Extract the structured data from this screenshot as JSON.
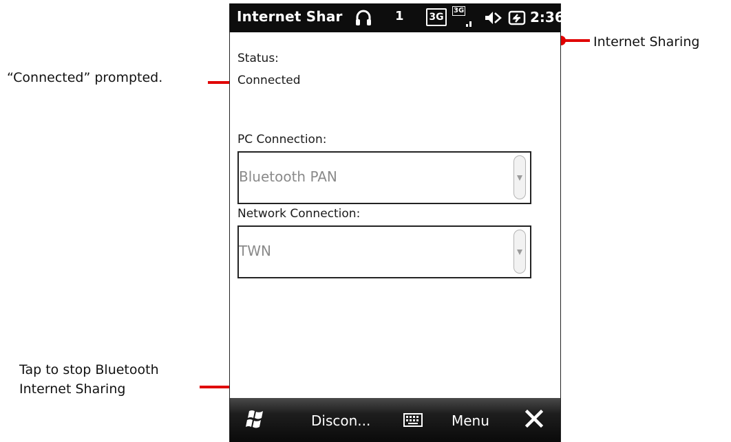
{
  "status_bar": {
    "title": "Internet Shar",
    "headset_icon": "headset-icon",
    "line_indicator": "1",
    "network_type": "3G",
    "signal_label": "3G",
    "speaker_icon": "speaker-muted-icon",
    "battery_icon": "battery-charging-icon",
    "time": "2:36"
  },
  "main": {
    "status_label": "Status:",
    "status_value": "Connected",
    "pc_connection_label": "PC Connection:",
    "pc_connection_value": "Bluetooth PAN",
    "network_connection_label": "Network Connection:",
    "network_connection_value": "TWN"
  },
  "softkeys": {
    "start_icon": "windows-start-icon",
    "left": "Discon...",
    "keyboard_icon": "keyboard-icon",
    "right": "Menu",
    "close_icon": "close-icon"
  },
  "callouts": {
    "internet_sharing": "Internet Sharing",
    "connected_prompted": "“Connected” prompted.",
    "tap_line1": "Tap to stop Bluetooth",
    "tap_line2": "Internet Sharing"
  },
  "colors": {
    "callout_line": "#e00000",
    "status_bar_bg": "#0d0d0d",
    "disabled_text": "#8a8a8a"
  }
}
